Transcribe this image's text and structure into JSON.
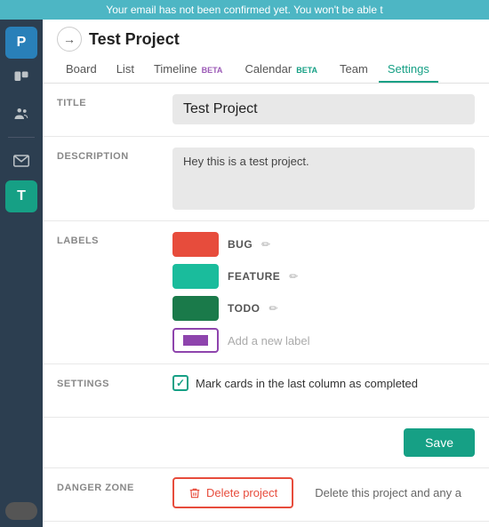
{
  "notification": {
    "text": "Your email has not been confirmed yet. You won't be able t"
  },
  "sidebar": {
    "items": [
      {
        "label": "P",
        "type": "avatar",
        "name": "avatar-p"
      },
      {
        "label": "⊞",
        "type": "icon",
        "name": "trello-icon"
      },
      {
        "label": "👥",
        "type": "icon",
        "name": "team-icon"
      },
      {
        "label": "✉",
        "type": "icon",
        "name": "mail-icon"
      },
      {
        "label": "T",
        "type": "avatar",
        "name": "t-avatar"
      }
    ]
  },
  "header": {
    "back_button": "→",
    "title": "Test Project"
  },
  "tabs": [
    {
      "label": "Board",
      "active": false,
      "beta": false
    },
    {
      "label": "List",
      "active": false,
      "beta": false
    },
    {
      "label": "Timeline",
      "active": false,
      "beta": true,
      "beta_color": "purple"
    },
    {
      "label": "Calendar",
      "active": false,
      "beta": true,
      "beta_color": "teal"
    },
    {
      "label": "Team",
      "active": false,
      "beta": false
    },
    {
      "label": "Settings",
      "active": true,
      "beta": false
    }
  ],
  "form": {
    "title_label": "TITLE",
    "title_value": "Test Project",
    "description_label": "DESCRIPTION",
    "description_value": "Hey this is a test project.",
    "labels_label": "LABELS",
    "labels": [
      {
        "color": "#e74c3c",
        "name": "BUG"
      },
      {
        "color": "#1abc9c",
        "name": "FEATURE"
      },
      {
        "color": "#1a7a4a",
        "name": "TODO"
      }
    ],
    "add_label_text": "Add a new label",
    "settings_label": "SETTINGS",
    "settings_check_text": "Mark cards in the last column as completed",
    "save_label": "Save",
    "danger_label": "DANGER ZONE",
    "delete_label": "Delete project",
    "delete_description": "Delete this project and any a"
  }
}
